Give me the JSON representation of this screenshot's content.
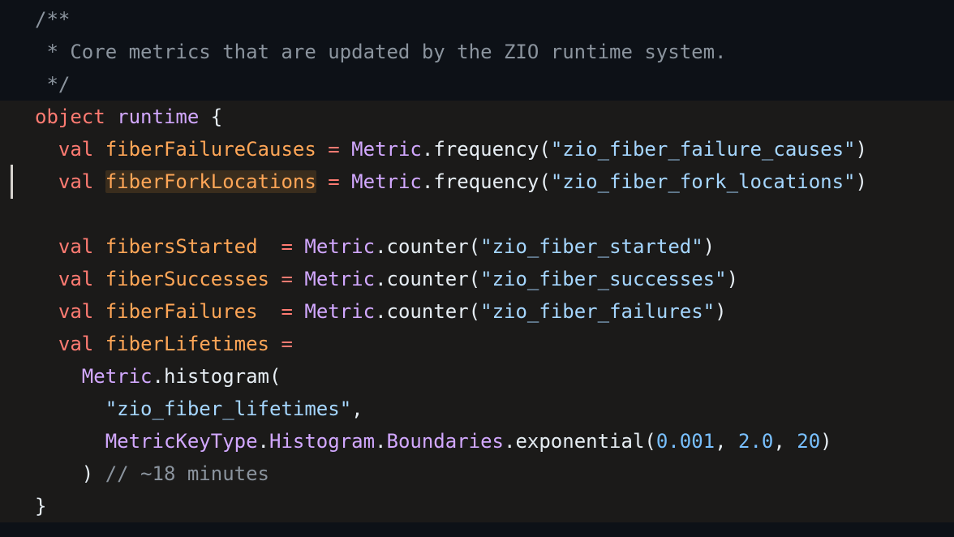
{
  "editor": {
    "language": "scala",
    "theme_colors": {
      "background": "#0d1117",
      "object_background": "#1b1a19",
      "keyword": "#ff7b72",
      "definition": "#ffa657",
      "type": "#d2a8ff",
      "string": "#a5d6ff",
      "number": "#79c0ff",
      "comment": "#8b949e",
      "highlight": "#3a2d1d"
    },
    "lines": [
      {
        "tokens": [
          {
            "cls": "comment",
            "text": "/**"
          }
        ]
      },
      {
        "tokens": [
          {
            "cls": "comment",
            "text": " * Core metrics that are updated by the ZIO runtime system."
          }
        ]
      },
      {
        "tokens": [
          {
            "cls": "comment",
            "text": " */"
          }
        ]
      },
      {
        "tokens": [
          {
            "cls": "kw",
            "text": "object"
          },
          {
            "cls": "punc",
            "text": " "
          },
          {
            "cls": "type",
            "text": "runtime"
          },
          {
            "cls": "punc",
            "text": " {"
          }
        ]
      },
      {
        "tokens": [
          {
            "cls": "punc",
            "text": "  "
          },
          {
            "cls": "kw",
            "text": "val"
          },
          {
            "cls": "punc",
            "text": " "
          },
          {
            "cls": "def",
            "text": "fiberFailureCauses"
          },
          {
            "cls": "punc",
            "text": " "
          },
          {
            "cls": "kw",
            "text": "="
          },
          {
            "cls": "punc",
            "text": " "
          },
          {
            "cls": "type",
            "text": "Metric"
          },
          {
            "cls": "punc",
            "text": ".frequency("
          },
          {
            "cls": "str",
            "text": "\"zio_fiber_failure_causes\""
          },
          {
            "cls": "punc",
            "text": ")"
          }
        ]
      },
      {
        "tokens": [
          {
            "cls": "punc",
            "text": "  "
          },
          {
            "cls": "kw",
            "text": "val"
          },
          {
            "cls": "punc",
            "text": " "
          },
          {
            "cls": "def hl",
            "text": "fiberForkLocations"
          },
          {
            "cls": "punc",
            "text": " "
          },
          {
            "cls": "kw",
            "text": "="
          },
          {
            "cls": "punc",
            "text": " "
          },
          {
            "cls": "type",
            "text": "Metric"
          },
          {
            "cls": "punc",
            "text": ".frequency("
          },
          {
            "cls": "str",
            "text": "\"zio_fiber_fork_locations\""
          },
          {
            "cls": "punc",
            "text": ")"
          }
        ]
      },
      {
        "tokens": []
      },
      {
        "tokens": [
          {
            "cls": "punc",
            "text": "  "
          },
          {
            "cls": "kw",
            "text": "val"
          },
          {
            "cls": "punc",
            "text": " "
          },
          {
            "cls": "def",
            "text": "fibersStarted"
          },
          {
            "cls": "punc",
            "text": "  "
          },
          {
            "cls": "kw",
            "text": "="
          },
          {
            "cls": "punc",
            "text": " "
          },
          {
            "cls": "type",
            "text": "Metric"
          },
          {
            "cls": "punc",
            "text": ".counter("
          },
          {
            "cls": "str",
            "text": "\"zio_fiber_started\""
          },
          {
            "cls": "punc",
            "text": ")"
          }
        ]
      },
      {
        "tokens": [
          {
            "cls": "punc",
            "text": "  "
          },
          {
            "cls": "kw",
            "text": "val"
          },
          {
            "cls": "punc",
            "text": " "
          },
          {
            "cls": "def",
            "text": "fiberSuccesses"
          },
          {
            "cls": "punc",
            "text": " "
          },
          {
            "cls": "kw",
            "text": "="
          },
          {
            "cls": "punc",
            "text": " "
          },
          {
            "cls": "type",
            "text": "Metric"
          },
          {
            "cls": "punc",
            "text": ".counter("
          },
          {
            "cls": "str",
            "text": "\"zio_fiber_successes\""
          },
          {
            "cls": "punc",
            "text": ")"
          }
        ]
      },
      {
        "tokens": [
          {
            "cls": "punc",
            "text": "  "
          },
          {
            "cls": "kw",
            "text": "val"
          },
          {
            "cls": "punc",
            "text": " "
          },
          {
            "cls": "def",
            "text": "fiberFailures"
          },
          {
            "cls": "punc",
            "text": "  "
          },
          {
            "cls": "kw",
            "text": "="
          },
          {
            "cls": "punc",
            "text": " "
          },
          {
            "cls": "type",
            "text": "Metric"
          },
          {
            "cls": "punc",
            "text": ".counter("
          },
          {
            "cls": "str",
            "text": "\"zio_fiber_failures\""
          },
          {
            "cls": "punc",
            "text": ")"
          }
        ]
      },
      {
        "tokens": [
          {
            "cls": "punc",
            "text": "  "
          },
          {
            "cls": "kw",
            "text": "val"
          },
          {
            "cls": "punc",
            "text": " "
          },
          {
            "cls": "def",
            "text": "fiberLifetimes"
          },
          {
            "cls": "punc",
            "text": " "
          },
          {
            "cls": "kw",
            "text": "="
          }
        ]
      },
      {
        "tokens": [
          {
            "cls": "punc",
            "text": "    "
          },
          {
            "cls": "type",
            "text": "Metric"
          },
          {
            "cls": "punc",
            "text": ".histogram("
          }
        ]
      },
      {
        "tokens": [
          {
            "cls": "punc",
            "text": "      "
          },
          {
            "cls": "str",
            "text": "\"zio_fiber_lifetimes\""
          },
          {
            "cls": "punc",
            "text": ","
          }
        ]
      },
      {
        "tokens": [
          {
            "cls": "punc",
            "text": "      "
          },
          {
            "cls": "type",
            "text": "MetricKeyType"
          },
          {
            "cls": "punc",
            "text": "."
          },
          {
            "cls": "type",
            "text": "Histogram"
          },
          {
            "cls": "punc",
            "text": "."
          },
          {
            "cls": "type",
            "text": "Boundaries"
          },
          {
            "cls": "punc",
            "text": ".exponential("
          },
          {
            "cls": "num",
            "text": "0.001"
          },
          {
            "cls": "punc",
            "text": ", "
          },
          {
            "cls": "num",
            "text": "2.0"
          },
          {
            "cls": "punc",
            "text": ", "
          },
          {
            "cls": "num",
            "text": "20"
          },
          {
            "cls": "punc",
            "text": ")"
          }
        ]
      },
      {
        "tokens": [
          {
            "cls": "punc",
            "text": "    ) "
          },
          {
            "cls": "comment",
            "text": "// ~18 minutes"
          }
        ]
      },
      {
        "tokens": [
          {
            "cls": "punc",
            "text": "}"
          }
        ]
      }
    ]
  }
}
